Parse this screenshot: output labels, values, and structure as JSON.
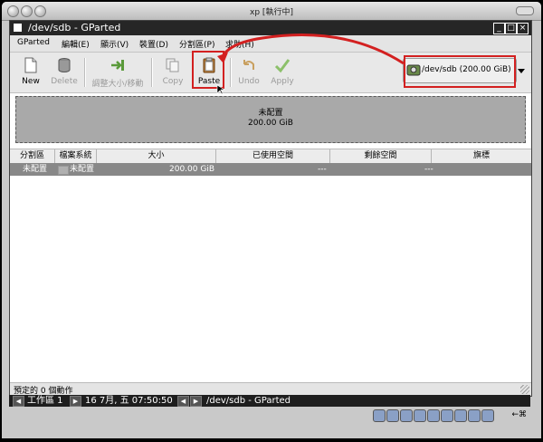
{
  "outer_window": {
    "title": "xp [執行中]"
  },
  "window": {
    "title": "/dev/sdb - GParted",
    "minimize": "_",
    "maximize": "□",
    "close": "×"
  },
  "menubar": {
    "items": [
      {
        "label": "GParted"
      },
      {
        "label": "編輯(E)"
      },
      {
        "label": "顯示(V)"
      },
      {
        "label": "裝置(D)"
      },
      {
        "label": "分割區(P)"
      },
      {
        "label": "求助(H)"
      }
    ]
  },
  "toolbar": {
    "new": "New",
    "delete": "Delete",
    "resize_move": "調整大小/移動",
    "copy": "Copy",
    "paste": "Paste",
    "undo": "Undo",
    "apply": "Apply"
  },
  "device_selector": {
    "label": "/dev/sdb  (200.00 GiB)"
  },
  "disk_map": {
    "line1": "未配置",
    "line2": "200.00 GiB"
  },
  "table": {
    "headers": [
      "分割區",
      "檔案系統",
      "大小",
      "已使用空間",
      "剩餘空間",
      "旗標"
    ],
    "rows": [
      {
        "partition": "未配置",
        "filesystem": "未配置",
        "size": "200.00 GiB",
        "used": "---",
        "unused": "---",
        "flags": ""
      }
    ]
  },
  "status": {
    "text": "預定的 0 個動作"
  },
  "taskbar": {
    "workspace": "工作區 1",
    "datetime": "16 7月, 五 07:50:50",
    "task": "/dev/sdb - GParted"
  },
  "host_key": "←⌘",
  "colors": {
    "annotation_red": "#d32020",
    "unallocated_gray": "#a9a9a9",
    "selected_row": "#888888"
  }
}
